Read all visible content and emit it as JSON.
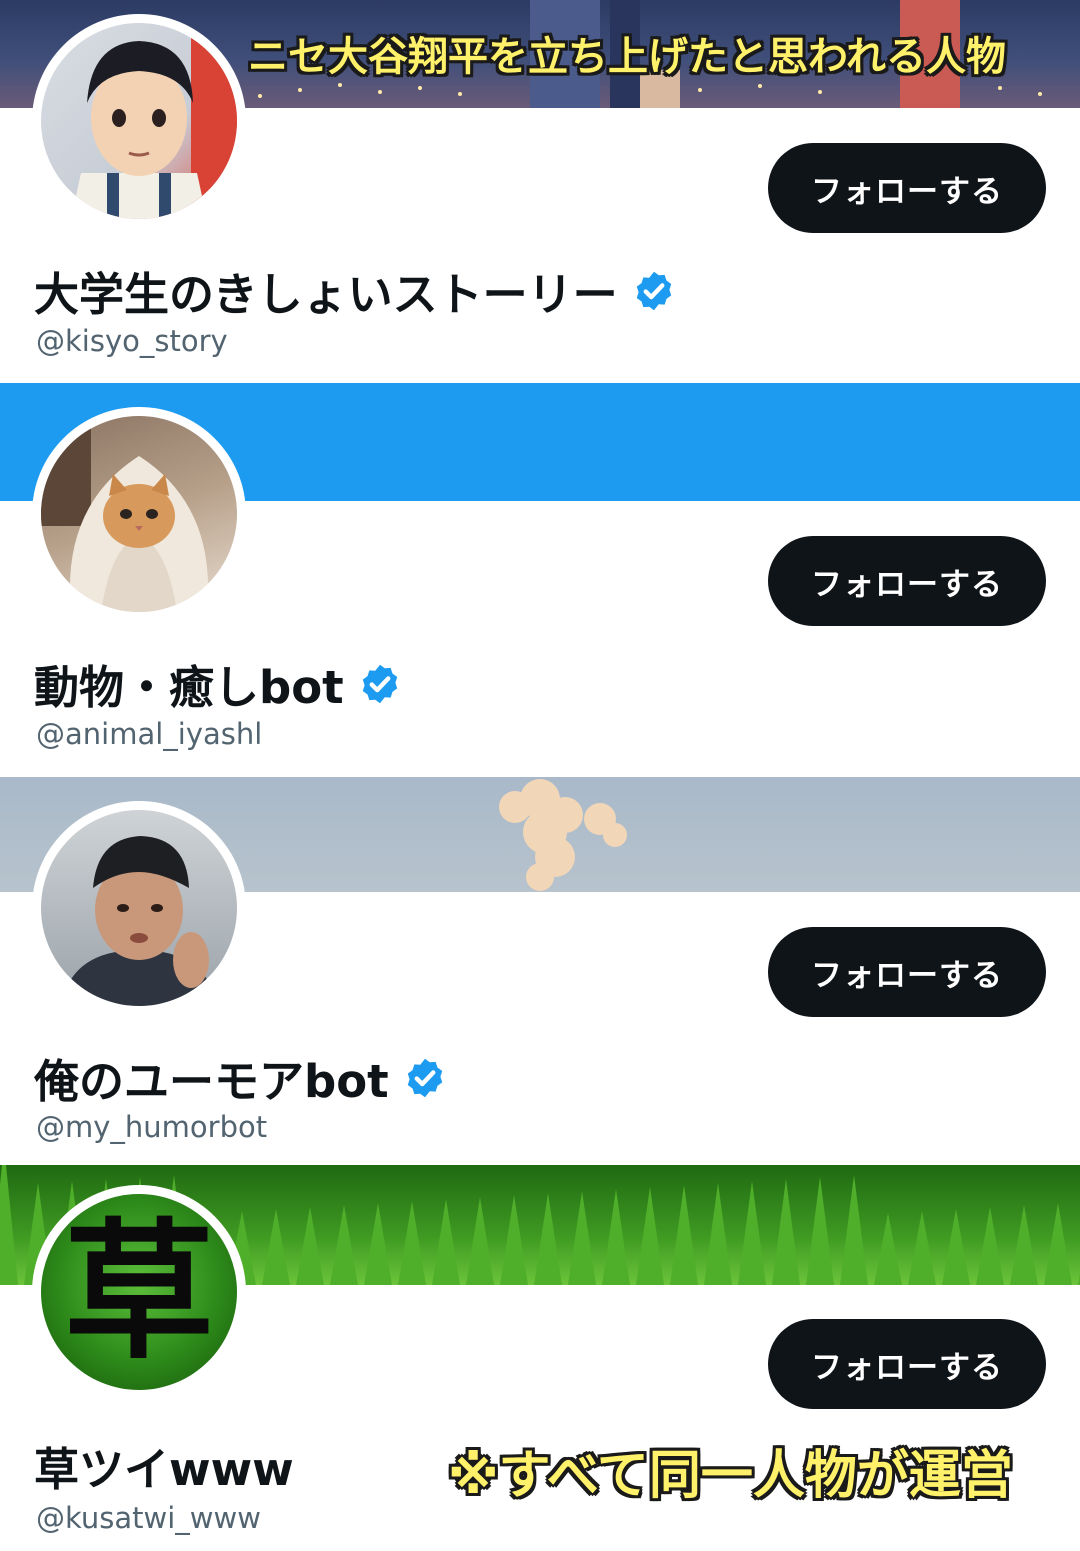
{
  "top_caption": "ニセ大谷翔平を立ち上げたと思われる人物",
  "bottom_caption": "※すべて同一人物が運営",
  "accounts": [
    {
      "name": "大学生のきしょいストーリー",
      "handle": "@kisyo_story",
      "follow_label": "フォローする",
      "verified": true,
      "avatar": "anime-boy-avatar",
      "banner": "night-city-anime-banner"
    },
    {
      "name": "動物・癒しbot",
      "handle": "@animal_iyashl",
      "follow_label": "フォローする",
      "verified": true,
      "avatar": "cat-in-blanket-avatar",
      "banner": "blue-banner"
    },
    {
      "name": "俺のユーモアbot",
      "handle": "@my_humorbot",
      "follow_label": "フォローする",
      "verified": true,
      "avatar": "man-in-cap-avatar",
      "banner": "sky-smoke-banner"
    },
    {
      "name": "草ツイwww",
      "handle": "@kusatwi_www",
      "follow_label": "フォローする",
      "verified": false,
      "avatar": "grass-kanji-avatar",
      "avatar_text": "草",
      "banner": "grass-banner"
    }
  ],
  "colors": {
    "button_bg": "#0f1419",
    "verified": "#1d9bf0",
    "handle": "#536471",
    "blue_banner": "#1d9bf0",
    "caption_fill": "#fff16a"
  }
}
